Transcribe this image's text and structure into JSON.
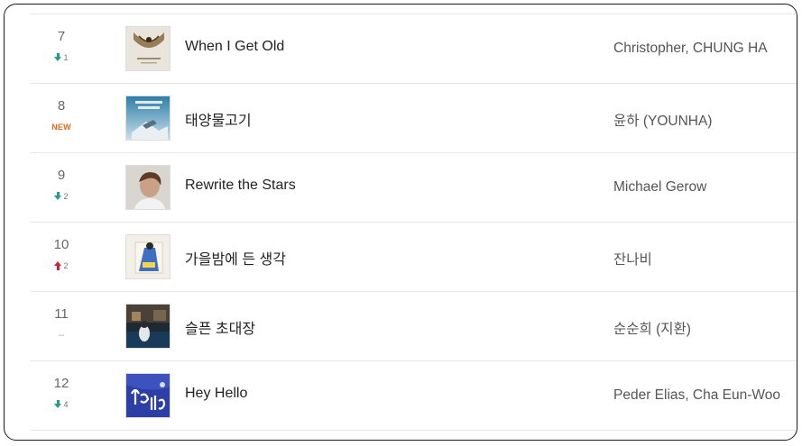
{
  "chart": {
    "rows": [
      {
        "rank": "7",
        "change_dir": "down",
        "change_value": "1",
        "title": "When I Get Old",
        "artist": "Christopher, CHUNG HA",
        "cover_icon": "album-cover-when-i-get-old"
      },
      {
        "rank": "8",
        "change_dir": "new",
        "change_value": "NEW",
        "title": "태양물고기",
        "artist": "윤하 (YOUNHA)",
        "cover_icon": "album-cover-growth-theory"
      },
      {
        "rank": "9",
        "change_dir": "down",
        "change_value": "2",
        "title": "Rewrite the Stars",
        "artist": "Michael Gerow",
        "cover_icon": "album-cover-portrait"
      },
      {
        "rank": "10",
        "change_dir": "up",
        "change_value": "2",
        "title": "가을밤에 든 생각",
        "artist": "잔나비",
        "cover_icon": "album-cover-illustration"
      },
      {
        "rank": "11",
        "change_dir": "same",
        "change_value": "–",
        "title": "슬픈 초대장",
        "artist": "순순희 (지환)",
        "cover_icon": "album-cover-night-scene"
      },
      {
        "rank": "12",
        "change_dir": "down",
        "change_value": "4",
        "title": "Hey Hello",
        "artist": "Peder Elias, Cha Eun-Woo",
        "cover_icon": "album-cover-hey-hello"
      }
    ]
  },
  "colors": {
    "down": "#1f9e8a",
    "up": "#d3203b",
    "new": "#e06a1b",
    "divider": "#e6e6e6"
  }
}
